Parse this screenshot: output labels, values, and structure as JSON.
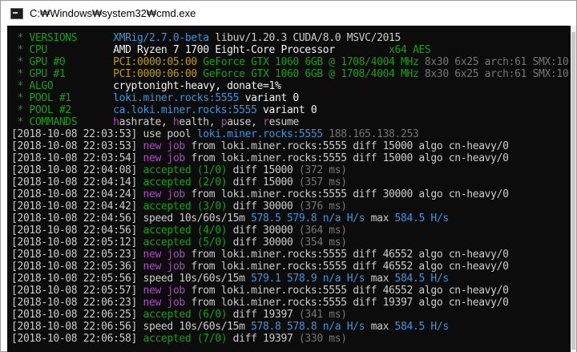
{
  "window": {
    "title": "C:₩Windows₩system32₩cmd.exe"
  },
  "header": [
    {
      "label": " * VERSIONS",
      "parts": [
        {
          "t": "XMRig/2.7.0-beta",
          "c": "c"
        },
        {
          "t": " libuv/1.20.3 CUDA/8.0 MSVC/2015",
          "c": "w"
        }
      ]
    },
    {
      "label": " * CPU",
      "parts": [
        {
          "t": "AMD Ryzen 7 1700 Eight-Core Processor",
          "c": "b"
        },
        {
          "t": "         x64 AES",
          "c": "g"
        }
      ]
    },
    {
      "label": " * GPU #0",
      "parts": [
        {
          "t": "PCI:0000:05:00 ",
          "c": "y"
        },
        {
          "t": "GeForce GTX 1060 6GB @ 1708/4004 MHz",
          "c": "g"
        },
        {
          "t": " 8x30 6x25 arch:61 SMX:10",
          "c": "d"
        }
      ]
    },
    {
      "label": " * GPU #1",
      "parts": [
        {
          "t": "PCI:0000:06:00 ",
          "c": "y"
        },
        {
          "t": "GeForce GTX 1060 6GB @ 1708/4004 MHz",
          "c": "g"
        },
        {
          "t": " 8x30 6x25 arch:61 SMX:10",
          "c": "d"
        }
      ]
    },
    {
      "label": " * ALGO",
      "parts": [
        {
          "t": "cryptonight-heavy, donate=1%",
          "c": "b"
        }
      ]
    },
    {
      "label": " * POOL #1",
      "parts": [
        {
          "t": "loki.miner.rocks:5555",
          "c": "c"
        },
        {
          "t": " variant 0",
          "c": "b"
        }
      ]
    },
    {
      "label": " * POOL #2",
      "parts": [
        {
          "t": "ca.loki.miner.rocks:5555",
          "c": "c"
        },
        {
          "t": " variant 0",
          "c": "b"
        }
      ]
    },
    {
      "label": " * COMMANDS",
      "parts": [
        {
          "t": "h",
          "c": "m"
        },
        {
          "t": "ashrate, ",
          "c": "w"
        },
        {
          "t": "h",
          "c": "m"
        },
        {
          "t": "ealth, ",
          "c": "w"
        },
        {
          "t": "p",
          "c": "m"
        },
        {
          "t": "ause, ",
          "c": "w"
        },
        {
          "t": "r",
          "c": "m"
        },
        {
          "t": "esume",
          "c": "w"
        }
      ]
    }
  ],
  "log": [
    {
      "ts": "[2018-10-08 22:03:53]",
      "parts": [
        {
          "t": " use pool ",
          "c": "w"
        },
        {
          "t": "loki.miner.rocks:5555",
          "c": "c"
        },
        {
          "t": " 188.165.138.253",
          "c": "d"
        }
      ]
    },
    {
      "ts": "[2018-10-08 22:03:53]",
      "parts": [
        {
          "t": " new job",
          "c": "m"
        },
        {
          "t": " from loki.miner.rocks:5555 diff 15000 algo cn-heavy/0",
          "c": "w"
        }
      ]
    },
    {
      "ts": "[2018-10-08 22:03:54]",
      "parts": [
        {
          "t": " new job",
          "c": "m"
        },
        {
          "t": " from loki.miner.rocks:5555 diff 15000 algo cn-heavy/0",
          "c": "w"
        }
      ]
    },
    {
      "ts": "[2018-10-08 22:04:08]",
      "parts": [
        {
          "t": " accepted (1/0)",
          "c": "g"
        },
        {
          "t": " diff 15000 ",
          "c": "w"
        },
        {
          "t": "(372 ms)",
          "c": "d"
        }
      ]
    },
    {
      "ts": "[2018-10-08 22:04:14]",
      "parts": [
        {
          "t": " accepted (2/0)",
          "c": "g"
        },
        {
          "t": " diff 15000 ",
          "c": "w"
        },
        {
          "t": "(357 ms)",
          "c": "d"
        }
      ]
    },
    {
      "ts": "[2018-10-08 22:04:24]",
      "parts": [
        {
          "t": " new job",
          "c": "m"
        },
        {
          "t": " from loki.miner.rocks:5555 diff 30000 algo cn-heavy/0",
          "c": "w"
        }
      ]
    },
    {
      "ts": "[2018-10-08 22:04:42]",
      "parts": [
        {
          "t": " accepted (3/0)",
          "c": "g"
        },
        {
          "t": " diff 30000 ",
          "c": "w"
        },
        {
          "t": "(376 ms)",
          "c": "d"
        }
      ]
    },
    {
      "ts": "[2018-10-08 22:04:56]",
      "parts": [
        {
          "t": " speed 10s/60s/15m ",
          "c": "w"
        },
        {
          "t": "578.5 579.8 n/a H/s",
          "c": "c"
        },
        {
          "t": " max ",
          "c": "w"
        },
        {
          "t": "584.5 H/s",
          "c": "c"
        }
      ]
    },
    {
      "ts": "[2018-10-08 22:04:56]",
      "parts": [
        {
          "t": " accepted (4/0)",
          "c": "g"
        },
        {
          "t": " diff 30000 ",
          "c": "w"
        },
        {
          "t": "(364 ms)",
          "c": "d"
        }
      ]
    },
    {
      "ts": "[2018-10-08 22:05:12]",
      "parts": [
        {
          "t": " accepted (5/0)",
          "c": "g"
        },
        {
          "t": " diff 30000 ",
          "c": "w"
        },
        {
          "t": "(354 ms)",
          "c": "d"
        }
      ]
    },
    {
      "ts": "[2018-10-08 22:05:23]",
      "parts": [
        {
          "t": " new job",
          "c": "m"
        },
        {
          "t": " from loki.miner.rocks:5555 diff 46552 algo cn-heavy/0",
          "c": "w"
        }
      ]
    },
    {
      "ts": "[2018-10-08 22:05:36]",
      "parts": [
        {
          "t": " new job",
          "c": "m"
        },
        {
          "t": " from loki.miner.rocks:5555 diff 46552 algo cn-heavy/0",
          "c": "w"
        }
      ]
    },
    {
      "ts": "[2018-10-08 22:05:56]",
      "parts": [
        {
          "t": " speed 10s/60s/15m ",
          "c": "w"
        },
        {
          "t": "579.1 578.9 n/a H/s",
          "c": "c"
        },
        {
          "t": " max ",
          "c": "w"
        },
        {
          "t": "584.5 H/s",
          "c": "c"
        }
      ]
    },
    {
      "ts": "[2018-10-08 22:05:57]",
      "parts": [
        {
          "t": " new job",
          "c": "m"
        },
        {
          "t": " from loki.miner.rocks:5555 diff 46552 algo cn-heavy/0",
          "c": "w"
        }
      ]
    },
    {
      "ts": "[2018-10-08 22:06:23]",
      "parts": [
        {
          "t": " new job",
          "c": "m"
        },
        {
          "t": " from loki.miner.rocks:5555 diff 19397 algo cn-heavy/0",
          "c": "w"
        }
      ]
    },
    {
      "ts": "[2018-10-08 22:06:25]",
      "parts": [
        {
          "t": " accepted (6/0)",
          "c": "g"
        },
        {
          "t": " diff 19397 ",
          "c": "w"
        },
        {
          "t": "(341 ms)",
          "c": "d"
        }
      ]
    },
    {
      "ts": "[2018-10-08 22:06:56]",
      "parts": [
        {
          "t": " speed 10s/60s/15m ",
          "c": "w"
        },
        {
          "t": "578.8 578.8 n/a H/s",
          "c": "c"
        },
        {
          "t": " max ",
          "c": "w"
        },
        {
          "t": "584.5 H/s",
          "c": "c"
        }
      ]
    },
    {
      "ts": "[2018-10-08 22:06:58]",
      "parts": [
        {
          "t": " accepted (7/0)",
          "c": "g"
        },
        {
          "t": " diff 19397 ",
          "c": "w"
        },
        {
          "t": "(330 ms)",
          "c": "d"
        }
      ]
    }
  ],
  "colors": {
    "console_bg": "#0c0c0c",
    "green": "#13a10e",
    "cyan": "#3a96dd",
    "magenta": "#b148c6",
    "gray": "#767676",
    "yellow": "#c19c00"
  }
}
